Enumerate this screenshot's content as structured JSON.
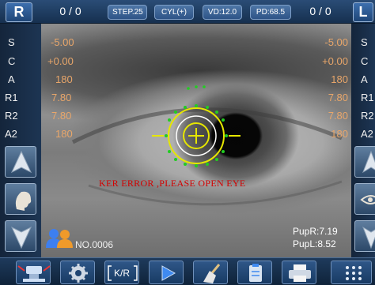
{
  "header": {
    "left_eye_label": "R",
    "right_eye_label": "L",
    "left_count": "0 / 0",
    "right_count": "0 / 0",
    "step": "STEP.25",
    "cyl": "CYL(+)",
    "vd": "VD:12.0",
    "pd": "PD:68.5"
  },
  "side_labels": [
    "S",
    "C",
    "A",
    "R1",
    "R2",
    "A2"
  ],
  "right_eye_values": [
    "-5.00",
    "+0.00",
    "180",
    "7.80",
    "7.80",
    "180"
  ],
  "left_eye_values": [
    "-5.00",
    "+0.00",
    "180",
    "7.80",
    "7.80",
    "180"
  ],
  "message": "KER ERROR ,PLEASE OPEN EYE",
  "pupil": {
    "right": "PupR:7.19",
    "left": "PupL:8.52"
  },
  "record_no": "NO.0006",
  "toolbar": {
    "kr_label": "K/R"
  },
  "colors": {
    "value_text": "#e8a66a",
    "error_text": "#d40000",
    "reticle_yellow": "#e6e600",
    "dot_green": "#22cc22"
  },
  "icons": [
    "up-arrow-icon",
    "head-icon",
    "down-arrow-icon",
    "users-icon",
    "microscope-icon",
    "gear-icon",
    "play-icon",
    "broom-icon",
    "clipboard-icon",
    "printer-icon",
    "grid-icon"
  ]
}
